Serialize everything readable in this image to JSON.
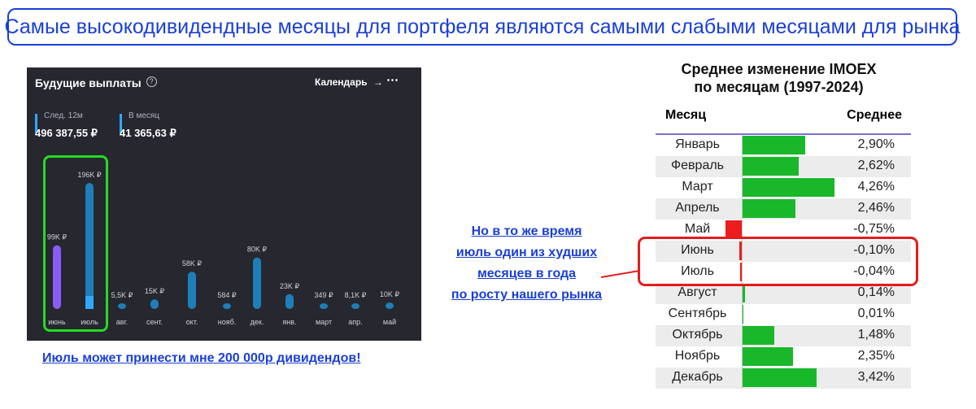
{
  "banner": {
    "text": "Самые высокодивидендные месяцы для портфеля являются самыми слабыми месяцами для рынка"
  },
  "dividends_widget": {
    "title": "Будущие выплаты",
    "info_icon": "info-icon",
    "calendar_label": "Календарь",
    "calendar_arrow": "→",
    "more_icon": "more-icon",
    "more_glyph": "⋯",
    "stats": [
      {
        "label": "След. 12м",
        "value": "496 387,55 ₽"
      },
      {
        "label": "В месяц",
        "value": "41 365,63 ₽"
      }
    ],
    "colors": {
      "background": "#26272f",
      "bar": "#1e7fb8",
      "highlight": "#8a5cf5",
      "accent": "#2fa8ff"
    }
  },
  "left_caption": "Июль может принести мне 200 000р дивидендов!",
  "callout": {
    "lines": [
      "Но в то же время",
      "июль один из худших",
      "месяцев в года",
      "по росту нашего рынка"
    ]
  },
  "table": {
    "title_lines": [
      "Среднее изменение IMOEX",
      "по месяцам (1997-2024)"
    ],
    "col_month": "Месяц",
    "col_avg": "Среднее",
    "colors": {
      "positive": "#19b82a",
      "negative": "#ee1c1c",
      "header_rule": "#7b6fd6",
      "highlight_box": "#e51c1c",
      "shade": "#ececec"
    }
  },
  "chart_data": [
    {
      "type": "bar",
      "categories": [
        "июнь",
        "июль",
        "авг.",
        "сент.",
        "окт.",
        "нояб.",
        "дек.",
        "янв.",
        "март",
        "апр.",
        "май"
      ],
      "values": [
        99000,
        196000,
        5500,
        15000,
        58000,
        584,
        80000,
        23000,
        349,
        8100,
        10000
      ],
      "data_labels": [
        "99K ₽",
        "196K ₽",
        "5,5K ₽",
        "15K ₽",
        "58K ₽",
        "584 ₽",
        "80K ₽",
        "23K ₽",
        "349 ₽",
        "8,1K ₽",
        "10K ₽"
      ],
      "highlighted_categories": [
        "июнь",
        "июль"
      ]
    },
    {
      "type": "bar",
      "title": "Среднее изменение IMOEX по месяцам (1997-2024)",
      "categories": [
        "Январь",
        "Февраль",
        "Март",
        "Апрель",
        "Май",
        "Июнь",
        "Июль",
        "Август",
        "Сентябрь",
        "Октябрь",
        "Ноябрь",
        "Декабрь"
      ],
      "values": [
        2.9,
        2.62,
        4.26,
        2.46,
        -0.75,
        -0.1,
        -0.04,
        0.14,
        0.01,
        1.48,
        2.35,
        3.42
      ],
      "value_labels": [
        "2,90%",
        "2,62%",
        "4,26%",
        "2,46%",
        "-0,75%",
        "-0,10%",
        "-0,04%",
        "0,14%",
        "0,01%",
        "1,48%",
        "2,35%",
        "3,42%"
      ],
      "highlighted_categories": [
        "Июнь",
        "Июль"
      ]
    }
  ]
}
